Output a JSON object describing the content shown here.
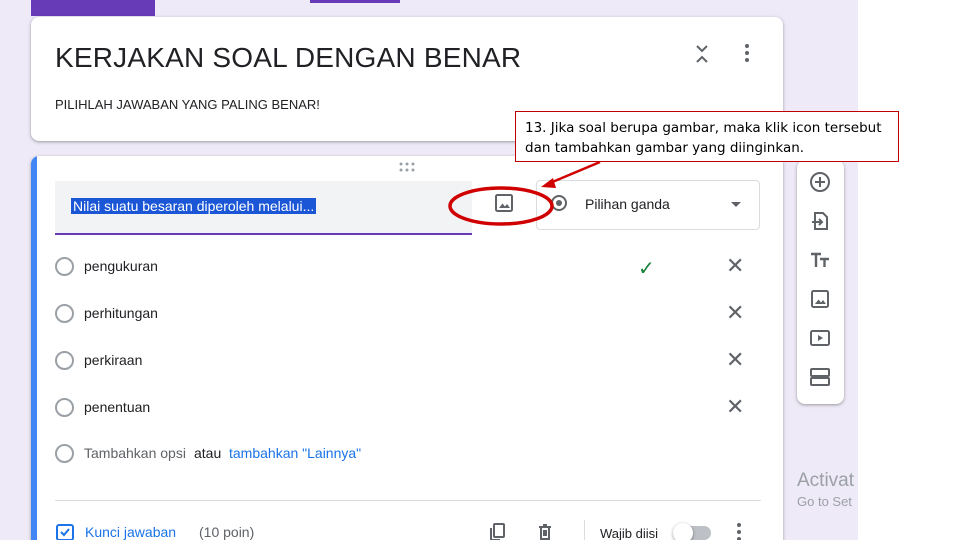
{
  "form": {
    "title": "KERJAKAN SOAL DENGAN BENAR",
    "description": "PILIHLAH JAWABAN YANG PALING BENAR!"
  },
  "question": {
    "text": "Nilai suatu besaran diperoleh melalui...",
    "type": "Pilihan ganda",
    "options": [
      {
        "label": "pengukuran",
        "correct": true
      },
      {
        "label": "perhitungan",
        "correct": false
      },
      {
        "label": "perkiraan",
        "correct": false
      },
      {
        "label": "penentuan",
        "correct": false
      }
    ],
    "add_option": "Tambahkan opsi",
    "or": "atau",
    "add_other": "tambahkan \"Lainnya\"",
    "answer_key": "Kunci jawaban",
    "points": "(10 poin)",
    "required": "Wajib diisi"
  },
  "annotation": {
    "text": "13. Jika soal berupa gambar, maka klik icon tersebut dan tambahkan gambar yang diinginkan."
  },
  "watermark": {
    "line1": "Activat",
    "line2": "Go to Set"
  },
  "icons": {
    "collapse": "collapse-icon",
    "more": "more-vert-icon",
    "drag": "drag-handle-icon",
    "add_image": "image-icon",
    "check": "check-icon",
    "remove": "close-icon",
    "answer_key": "checkbox-icon",
    "duplicate": "copy-icon",
    "delete": "trash-icon",
    "add_question": "add-circle-icon",
    "import": "import-icon",
    "title_text": "text-icon",
    "add_video": "video-icon",
    "add_section": "section-icon"
  },
  "colors": {
    "theme": "#673ab7",
    "active_border": "#4285f4",
    "background": "#efeaf8",
    "link": "#1a73e8",
    "check": "#188038",
    "annotation_border": "#c00000",
    "highlight": "#1a56d6"
  }
}
